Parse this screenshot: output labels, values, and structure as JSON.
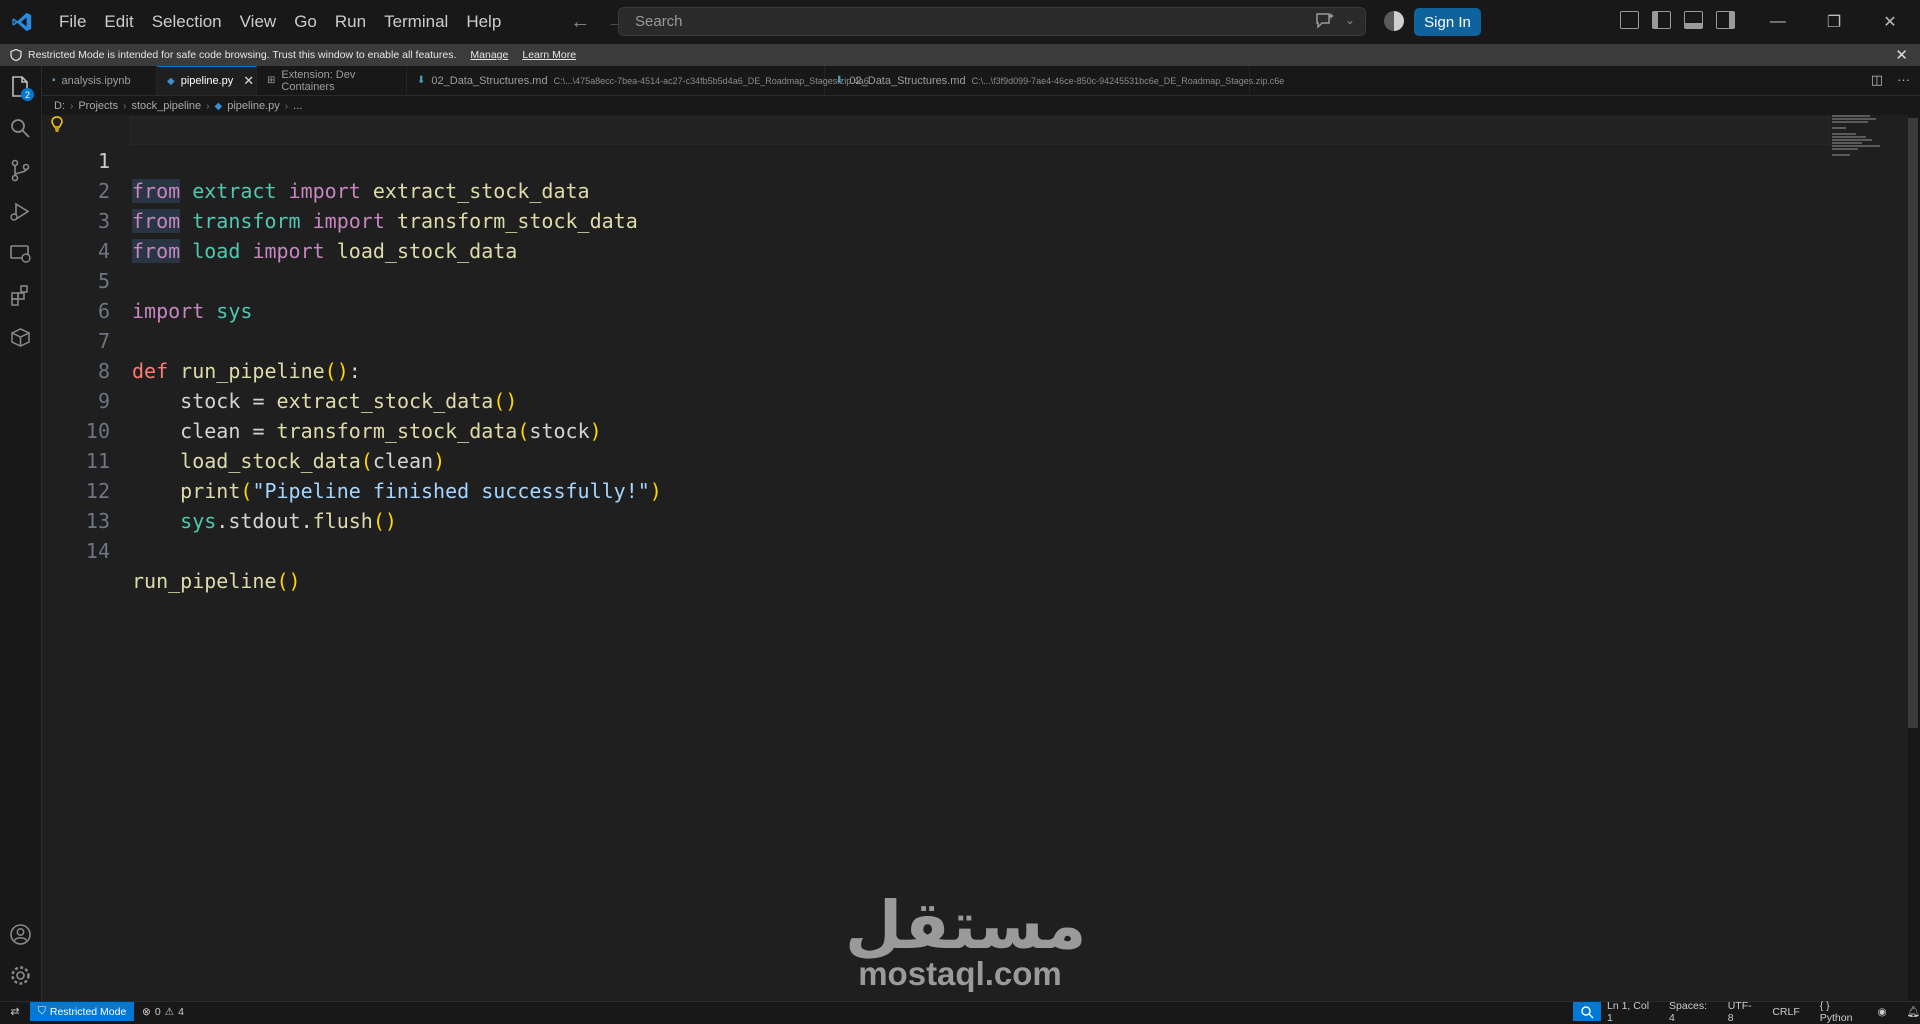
{
  "menu": [
    "File",
    "Edit",
    "Selection",
    "View",
    "Go",
    "Run",
    "Terminal",
    "Help"
  ],
  "search": {
    "placeholder": "Search"
  },
  "account": {
    "sign_in_label": "Sign In"
  },
  "banner": {
    "message": "Restricted Mode is intended for safe code browsing. Trust this window to enable all features.",
    "manage_label": "Manage",
    "learn_more_label": "Learn More"
  },
  "activity": {
    "source_control_badge": "2"
  },
  "tabs": [
    {
      "label": "analysis.ipynb",
      "path": "",
      "icon": "notebook-icon",
      "active": false,
      "dirty": false
    },
    {
      "label": "pipeline.py",
      "path": "",
      "icon": "python-icon",
      "active": true,
      "dirty": false
    },
    {
      "label": "Extension: Dev Containers",
      "path": "",
      "icon": "extension-icon",
      "active": false,
      "dirty": false
    },
    {
      "label": "02_Data_Structures.md",
      "path": "C:\\...\\475a8ecc-7bea-4514-ac27-c34fb5b5d4a6_DE_Roadmap_Stages.zip.4a6",
      "icon": "markdown-icon",
      "active": false,
      "dirty": true
    },
    {
      "label": "02_Data_Structures.md",
      "path": "C:\\...\\f3f9d099-7ae4-46ce-850c-94245531bc6e_DE_Roadmap_Stages.zip.c6e",
      "icon": "markdown-icon",
      "active": false,
      "dirty": true
    }
  ],
  "breadcrumb": [
    "D:",
    "Projects",
    "stock_pipeline",
    "pipeline.py",
    "..."
  ],
  "code": {
    "line_numbers": [
      "1",
      "2",
      "3",
      "4",
      "5",
      "6",
      "7",
      "8",
      "9",
      "10",
      "11",
      "12",
      "13",
      "14"
    ],
    "current_line": "1"
  },
  "watermark": {
    "arabic": "مستقل",
    "latin": "mostaql.com"
  },
  "status": {
    "restricted_label": "Restricted Mode",
    "errors": "0",
    "warnings": "4",
    "position": "Ln 1, Col 1",
    "spaces": "Spaces: 4",
    "encoding": "UTF-8",
    "eol": "CRLF",
    "language": "Python"
  },
  "colors": {
    "accent": "#0078d4",
    "signin": "#0e639c",
    "editor_bg": "#1f1f1f",
    "keyword": "#c586c0",
    "module": "#4ec9b0",
    "function": "#dcdcaa",
    "string": "#ce9178",
    "def": "#569cd6"
  }
}
